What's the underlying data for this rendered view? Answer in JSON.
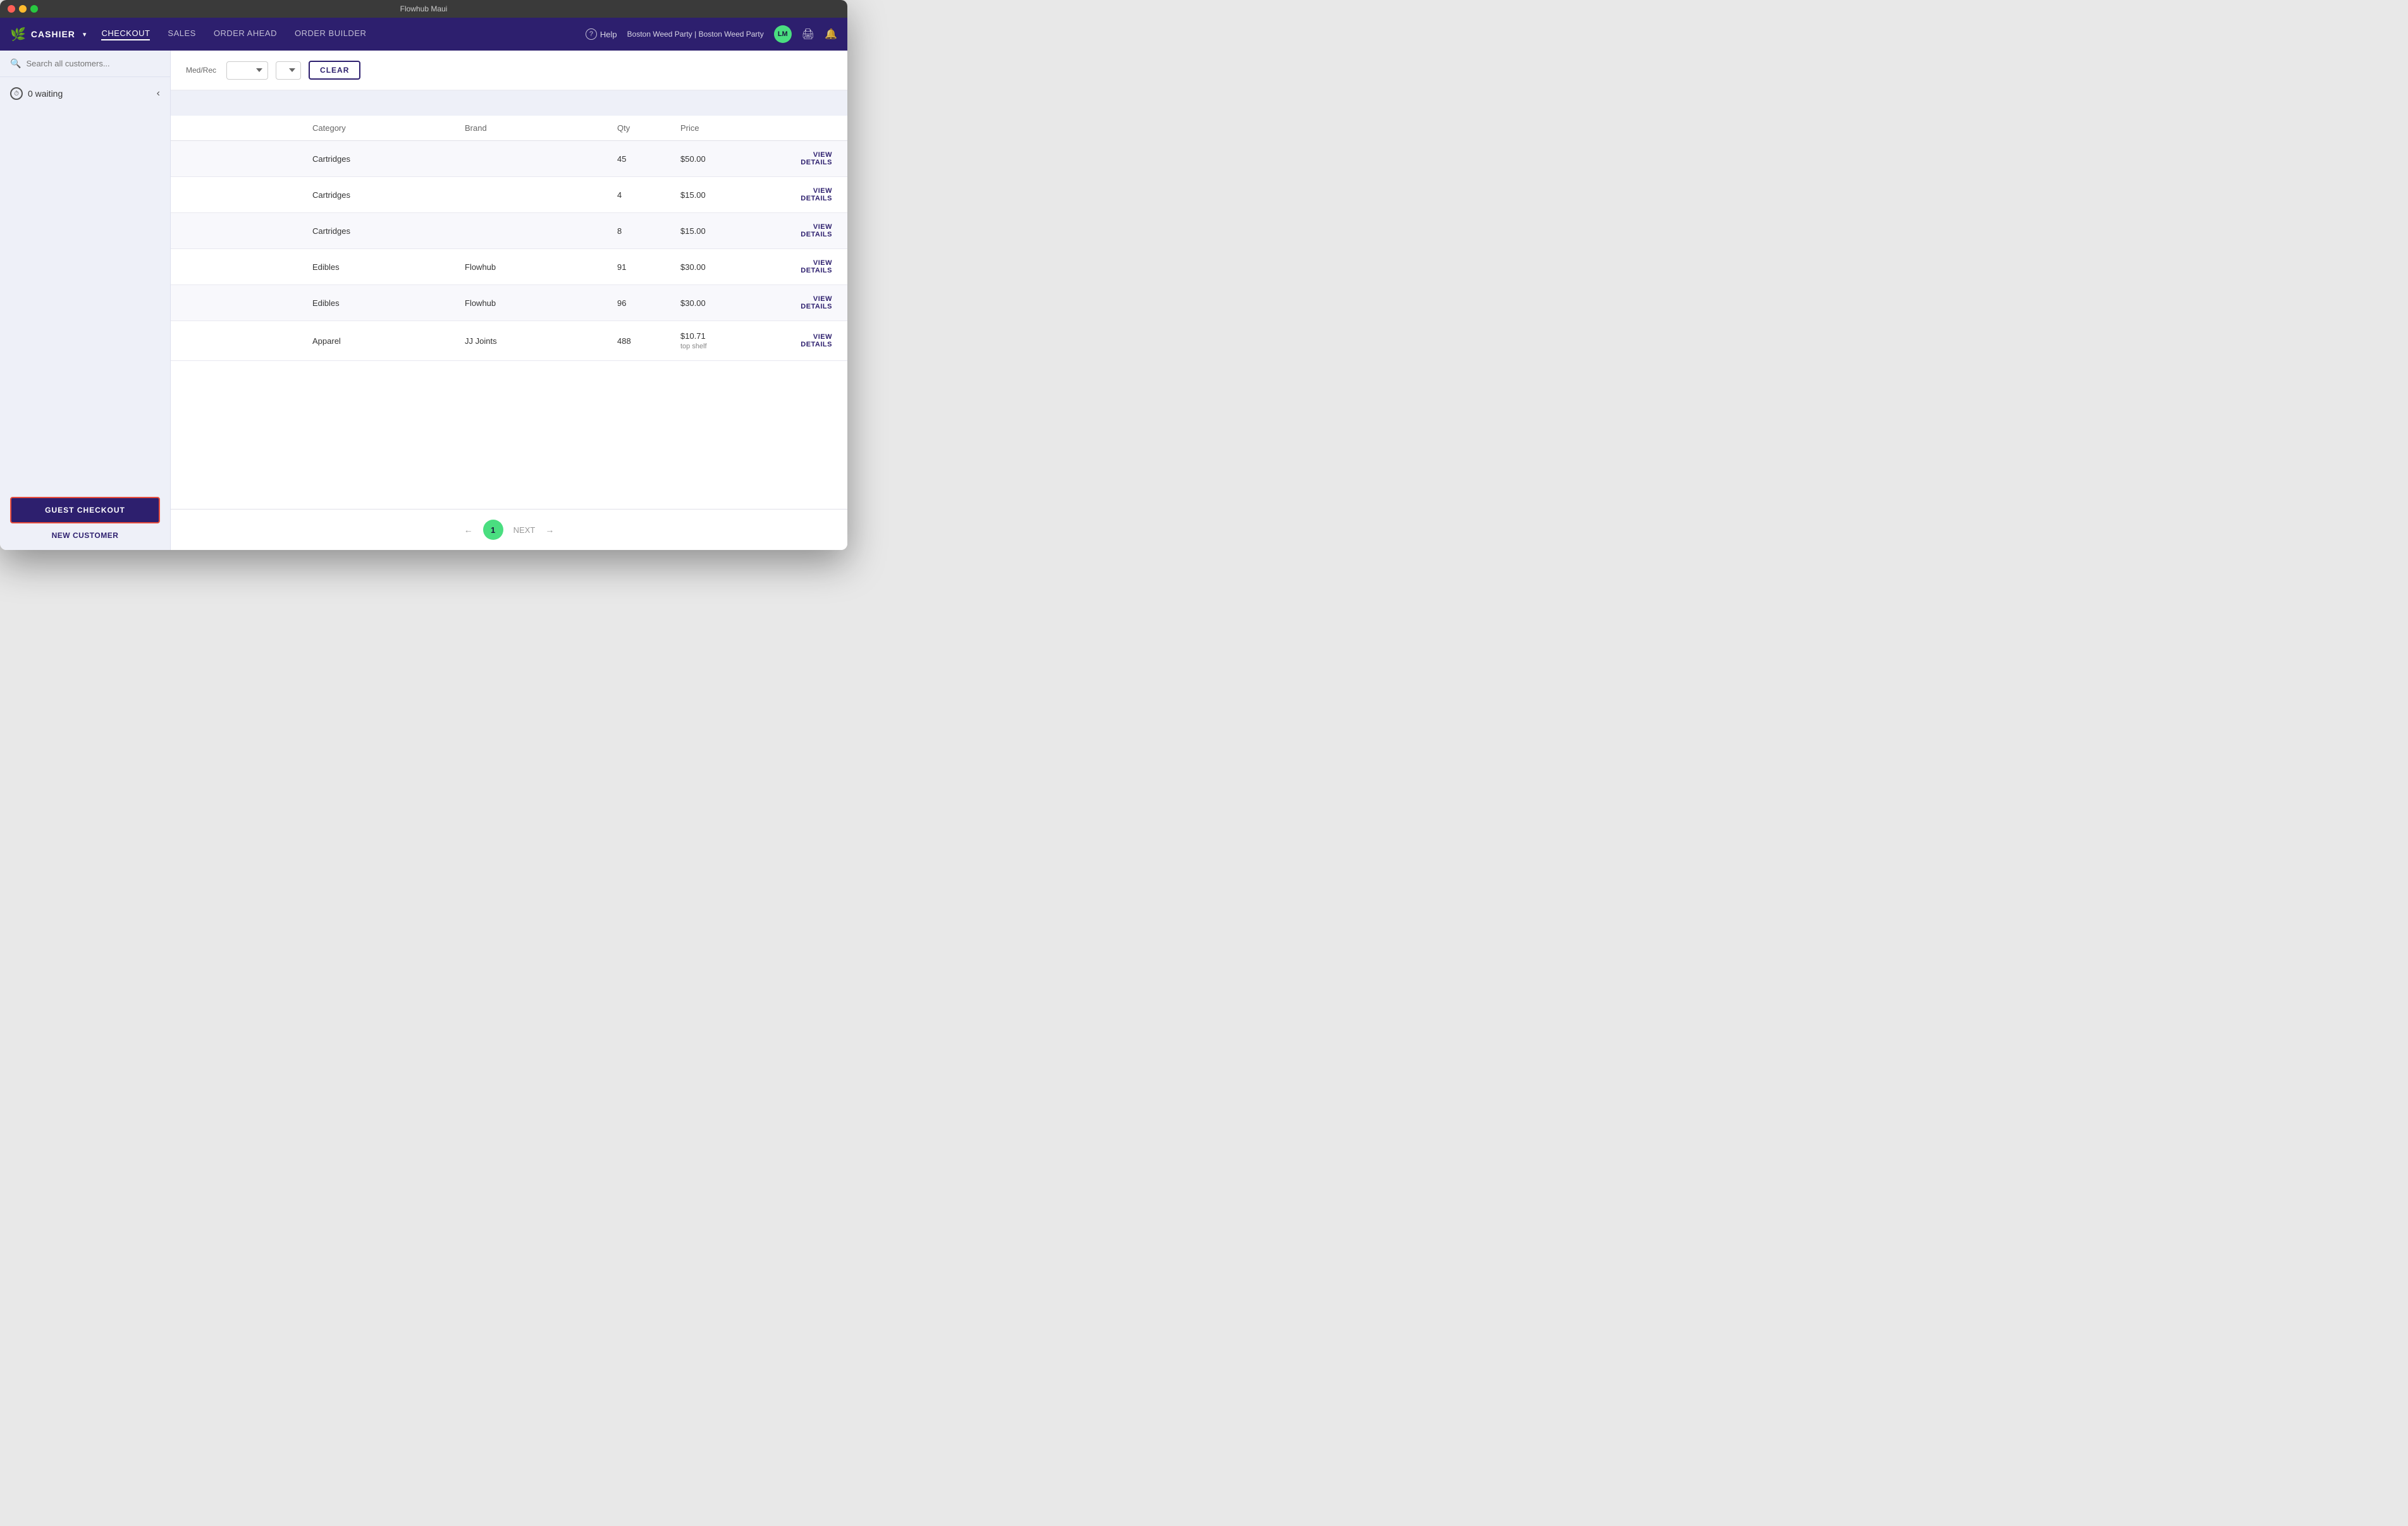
{
  "window": {
    "title": "Flowhub Maui"
  },
  "nav": {
    "logo": "🌿",
    "cashier_label": "CASHIER",
    "cashier_dropdown": "▾",
    "items": [
      {
        "id": "checkout",
        "label": "CHECKOUT",
        "active": true
      },
      {
        "id": "sales",
        "label": "SALES",
        "active": false
      },
      {
        "id": "order_ahead",
        "label": "ORDER AHEAD",
        "active": false
      },
      {
        "id": "order_builder",
        "label": "ORDER BUILDER",
        "active": false
      }
    ],
    "help_label": "Help",
    "store_name": "Boston Weed Party | Boston Weed Party",
    "avatar_initials": "LM"
  },
  "sidebar": {
    "search_placeholder": "Search all customers...",
    "waiting_count": "0 waiting",
    "guest_checkout_label": "GUEST CHECKOUT",
    "new_customer_label": "NEW CUSTOMER"
  },
  "filters": {
    "med_rec_label": "Med/Rec",
    "dropdown1_value": "",
    "dropdown2_value": "",
    "clear_label": "CLEAR"
  },
  "table": {
    "headers": [
      "",
      "Category",
      "Brand",
      "Qty",
      "Price",
      ""
    ],
    "rows": [
      {
        "col1": "",
        "category": "Cartridges",
        "brand": "",
        "qty": "45",
        "price": "$50.00",
        "price_note": "",
        "action": "VIEW\nDETAILS"
      },
      {
        "col1": "",
        "category": "Cartridges",
        "brand": "",
        "qty": "4",
        "price": "$15.00",
        "price_note": "",
        "action": "VIEW\nDETAILS"
      },
      {
        "col1": "",
        "category": "Cartridges",
        "brand": "",
        "qty": "8",
        "price": "$15.00",
        "price_note": "",
        "action": "VIEW\nDETAILS"
      },
      {
        "col1": "",
        "category": "Edibles",
        "brand": "Flowhub",
        "qty": "91",
        "price": "$30.00",
        "price_note": "",
        "action": "VIEW\nDETAILS"
      },
      {
        "col1": "",
        "category": "Edibles",
        "brand": "Flowhub",
        "qty": "96",
        "price": "$30.00",
        "price_note": "",
        "action": "VIEW\nDETAILS"
      },
      {
        "col1": "",
        "category": "Apparel",
        "brand": "JJ Joints",
        "qty": "488",
        "price": "$10.71",
        "price_note": "top shelf",
        "action": "VIEW\nDETAILS"
      }
    ]
  },
  "pagination": {
    "prev_label": "←",
    "page_number": "1",
    "next_label": "NEXT",
    "next_arrow": "→"
  }
}
